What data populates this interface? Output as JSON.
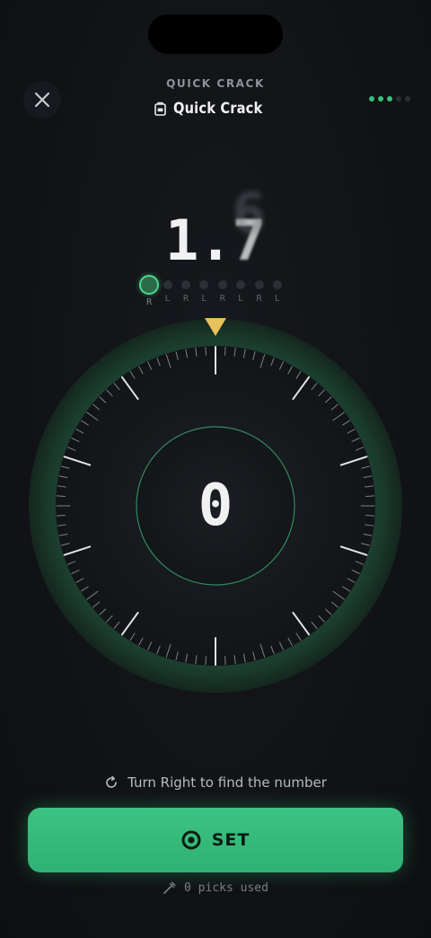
{
  "header": {
    "subtitle": "QUICK CRACK",
    "title": "Quick Crack",
    "progress": {
      "total": 5,
      "completed": 3
    }
  },
  "code": {
    "entered": "1.",
    "spinning_digit": "7",
    "ghost_digit": "6"
  },
  "sequence": [
    {
      "dir": "R",
      "active": true
    },
    {
      "dir": "L",
      "active": false
    },
    {
      "dir": "R",
      "active": false
    },
    {
      "dir": "L",
      "active": false
    },
    {
      "dir": "R",
      "active": false
    },
    {
      "dir": "L",
      "active": false
    },
    {
      "dir": "R",
      "active": false
    },
    {
      "dir": "L",
      "active": false
    }
  ],
  "dial": {
    "value": "0",
    "pointer_color": "#e9c15a",
    "ring_color": "#35c27a"
  },
  "hint": {
    "text": "Turn Right to find the number",
    "icon": "rotate-cw-icon"
  },
  "set_button": {
    "label": "SET",
    "icon": "target-icon"
  },
  "picks": {
    "text": "0 picks used",
    "icon": "pick-icon"
  },
  "colors": {
    "accent": "#35c27a",
    "background": "#111316"
  }
}
